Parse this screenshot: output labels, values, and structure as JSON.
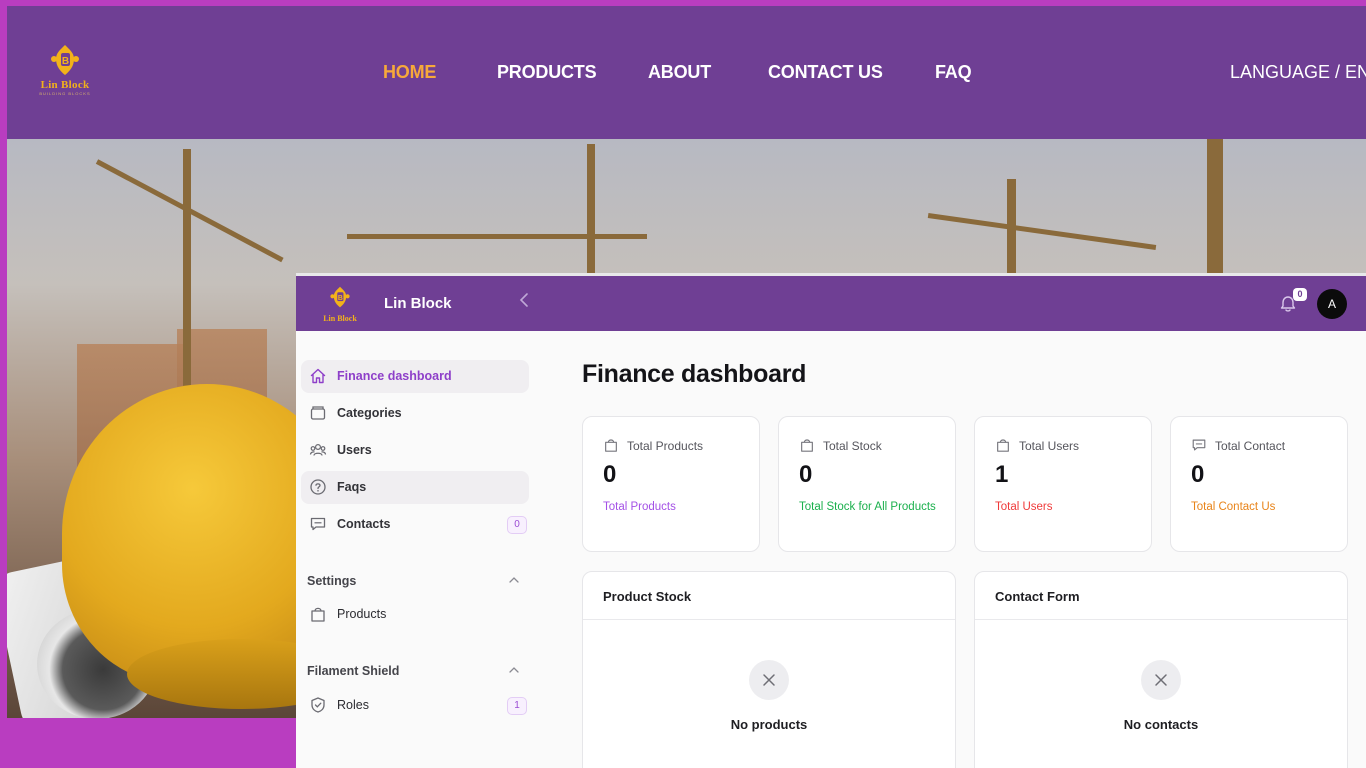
{
  "website": {
    "logo": {
      "brand": "Lin Block",
      "tagline": "BUILDING BLOCKS"
    },
    "nav": [
      {
        "label": "HOME",
        "active": true
      },
      {
        "label": "PRODUCTS",
        "active": false
      },
      {
        "label": "ABOUT",
        "active": false
      },
      {
        "label": "CONTACT US",
        "active": false
      },
      {
        "label": "FAQ",
        "active": false
      }
    ],
    "language": "LANGUAGE / EN"
  },
  "admin": {
    "topbar": {
      "brand": "Lin Block",
      "logo_text": "Lin Block",
      "notifications_count": "0",
      "avatar_initial": "A"
    },
    "sidebar": {
      "items": [
        {
          "label": "Finance dashboard",
          "icon": "home-icon",
          "active": true
        },
        {
          "label": "Categories",
          "icon": "stack-icon"
        },
        {
          "label": "Users",
          "icon": "users-icon"
        },
        {
          "label": "Faqs",
          "icon": "question-circle-icon"
        },
        {
          "label": "Contacts",
          "icon": "chat-icon",
          "badge": "0"
        }
      ],
      "groups": [
        {
          "label": "Settings",
          "items": [
            {
              "label": "Products",
              "icon": "shopping-bag-icon"
            }
          ]
        },
        {
          "label": "Filament Shield",
          "items": [
            {
              "label": "Roles",
              "icon": "shield-check-icon",
              "badge": "1"
            }
          ]
        }
      ]
    },
    "main": {
      "title": "Finance dashboard",
      "stats": [
        {
          "label": "Total Products",
          "value": "0",
          "description": "Total Products",
          "color": "#a451e6",
          "icon": "shopping-bag-icon"
        },
        {
          "label": "Total Stock",
          "value": "0",
          "description": "Total Stock for All Products",
          "color": "#1bb04d",
          "icon": "shopping-bag-icon"
        },
        {
          "label": "Total Users",
          "value": "1",
          "description": "Total Users",
          "color": "#ef3a3a",
          "icon": "shopping-bag-icon"
        },
        {
          "label": "Total Contact",
          "value": "0",
          "description": "Total Contact Us",
          "color": "#e8841a",
          "icon": "chat-icon"
        }
      ],
      "panels": [
        {
          "title": "Product Stock",
          "empty_text": "No products"
        },
        {
          "title": "Contact Form",
          "empty_text": "No contacts"
        }
      ]
    }
  },
  "colors": {
    "page_background": "#b93dc0",
    "nav_purple": "#6f3f94",
    "nav_active": "#f7a93a",
    "accent": "#8e3fc9"
  }
}
